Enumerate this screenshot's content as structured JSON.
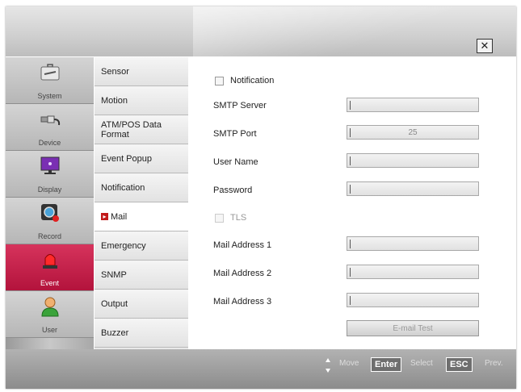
{
  "window": {
    "close_glyph": "✕"
  },
  "nav": [
    {
      "id": "system",
      "label": "System",
      "icon": "toolbox-icon"
    },
    {
      "id": "device",
      "label": "Device",
      "icon": "usb-cable-icon"
    },
    {
      "id": "display",
      "label": "Display",
      "icon": "monitor-icon"
    },
    {
      "id": "record",
      "label": "Record",
      "icon": "camera-record-icon"
    },
    {
      "id": "event",
      "label": "Event",
      "icon": "alarm-siren-icon",
      "active": true
    },
    {
      "id": "user",
      "label": "User",
      "icon": "user-icon"
    }
  ],
  "subnav": [
    {
      "label": "Sensor"
    },
    {
      "label": "Motion"
    },
    {
      "label": "ATM/POS Data Format"
    },
    {
      "label": "Event Popup"
    },
    {
      "label": "Notification"
    },
    {
      "label": "Mail",
      "active": true
    },
    {
      "label": "Emergency"
    },
    {
      "label": "SNMP"
    },
    {
      "label": "Output"
    },
    {
      "label": "Buzzer"
    }
  ],
  "form": {
    "notification_label": "Notification",
    "smtp_server_label": "SMTP Server",
    "smtp_server_value": "",
    "smtp_port_label": "SMTP Port",
    "smtp_port_value": "25",
    "user_name_label": "User Name",
    "user_name_value": "",
    "password_label": "Password",
    "password_value": "",
    "tls_label": "TLS",
    "mail1_label": "Mail Address 1",
    "mail2_label": "Mail Address 2",
    "mail3_label": "Mail Address 3",
    "email_test_label": "E-mail Test"
  },
  "footer": {
    "move": "Move",
    "enter_key": "Enter",
    "select": "Select",
    "esc_key": "ESC",
    "prev": "Prev."
  },
  "colors": {
    "accent": "#c5234b",
    "mail_marker": "#c21b1b"
  }
}
